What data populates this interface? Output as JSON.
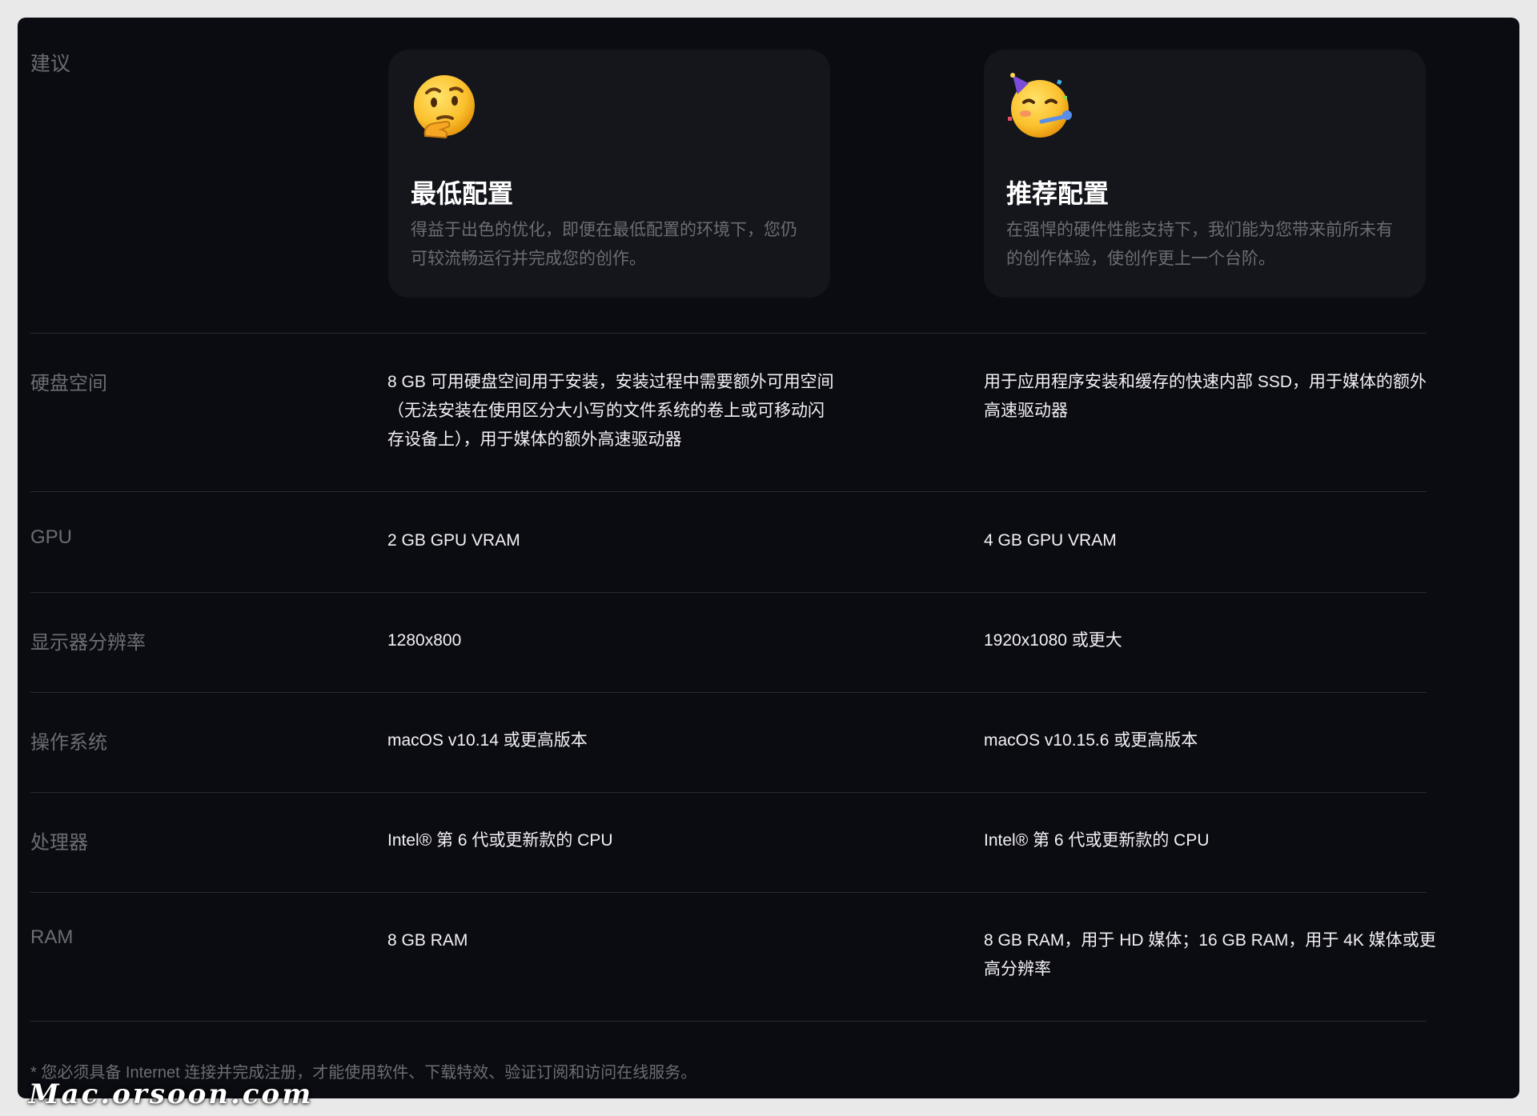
{
  "header": {
    "section_label": "建议"
  },
  "cards": [
    {
      "icon": "thinking-face-icon",
      "title": "最低配置",
      "desc": "得益于出色的优化，即便在最低配置的环境下，您仍可较流畅运行并完成您的创作。"
    },
    {
      "icon": "partying-face-icon",
      "title": "推荐配置",
      "desc": "在强悍的硬件性能支持下，我们能为您带来前所未有的创作体验，使创作更上一个台阶。"
    }
  ],
  "rows": [
    {
      "label": "硬盘空间",
      "min": "8 GB 可用硬盘空间用于安装，安装过程中需要额外可用空间（无法安装在使用区分大小写的文件系统的卷上或可移动闪存设备上），用于媒体的额外高速驱动器",
      "rec": "用于应用程序安装和缓存的快速内部 SSD，用于媒体的额外高速驱动器"
    },
    {
      "label": "GPU",
      "min": "2 GB GPU VRAM",
      "rec": "4 GB GPU VRAM"
    },
    {
      "label": "显示器分辨率",
      "min": "1280x800",
      "rec": "1920x1080 或更大"
    },
    {
      "label": "操作系统",
      "min": "macOS v10.14 或更高版本",
      "rec": "macOS v10.15.6 或更高版本"
    },
    {
      "label": "处理器",
      "min": "Intel® 第 6 代或更新款的 CPU",
      "rec": "Intel® 第 6 代或更新款的 CPU"
    },
    {
      "label": "RAM",
      "min": "8 GB RAM",
      "rec": "8 GB RAM，用于 HD 媒体；16 GB RAM，用于 4K 媒体或更高分辨率"
    }
  ],
  "footnote": "* 您必须具备 Internet 连接并完成注册，才能使用软件、下载特效、验证订阅和访问在线服务。",
  "watermark": "Mac.orsoon.com"
}
